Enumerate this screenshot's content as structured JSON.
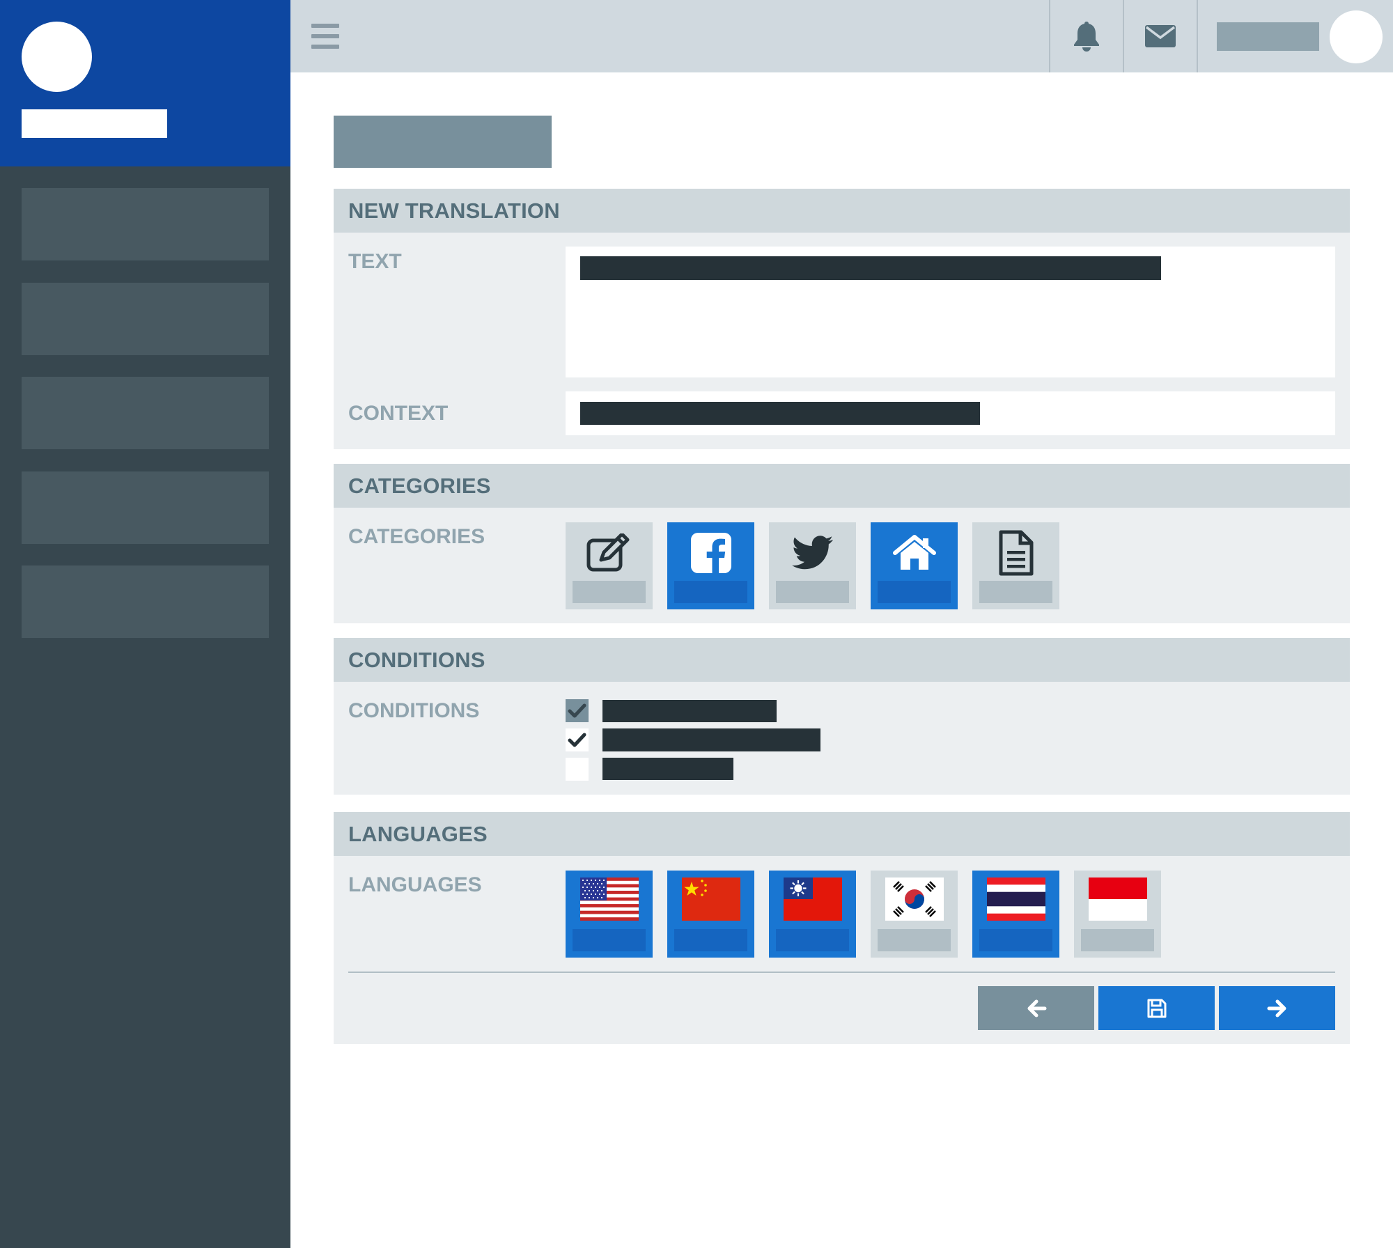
{
  "sections": {
    "new_translation": {
      "title": "NEW TRANSLATION",
      "text_label": "TEXT",
      "context_label": "CONTEXT"
    },
    "categories": {
      "title": "CATEGORIES",
      "label": "CATEGORIES",
      "items": [
        {
          "icon": "edit-icon",
          "selected": false
        },
        {
          "icon": "facebook-icon",
          "selected": true
        },
        {
          "icon": "twitter-icon",
          "selected": false
        },
        {
          "icon": "home-icon",
          "selected": true
        },
        {
          "icon": "document-icon",
          "selected": false
        }
      ]
    },
    "conditions": {
      "title": "CONDITIONS",
      "label": "CONDITIONS",
      "items": [
        {
          "state": "checked-disabled"
        },
        {
          "state": "checked"
        },
        {
          "state": "unchecked"
        }
      ]
    },
    "languages": {
      "title": "LANGUAGES",
      "label": "LANGUAGES",
      "items": [
        {
          "flag": "us-flag",
          "selected": true
        },
        {
          "flag": "china-flag",
          "selected": true
        },
        {
          "flag": "taiwan-flag",
          "selected": true
        },
        {
          "flag": "south-korea-flag",
          "selected": false
        },
        {
          "flag": "thailand-flag",
          "selected": true
        },
        {
          "flag": "indonesia-flag",
          "selected": false
        }
      ]
    }
  },
  "footer": {
    "buttons": [
      {
        "icon": "arrow-left-icon"
      },
      {
        "icon": "save-icon"
      },
      {
        "icon": "arrow-right-icon"
      }
    ]
  },
  "topbar": {
    "icons": [
      "menu-icon",
      "bell-icon",
      "mail-icon"
    ]
  },
  "colors": {
    "brand": "#0d47a1",
    "sidebar": "#37474f",
    "accent": "#1976d2",
    "panel": "#eceff1",
    "panel_header": "#cfd8dc"
  }
}
